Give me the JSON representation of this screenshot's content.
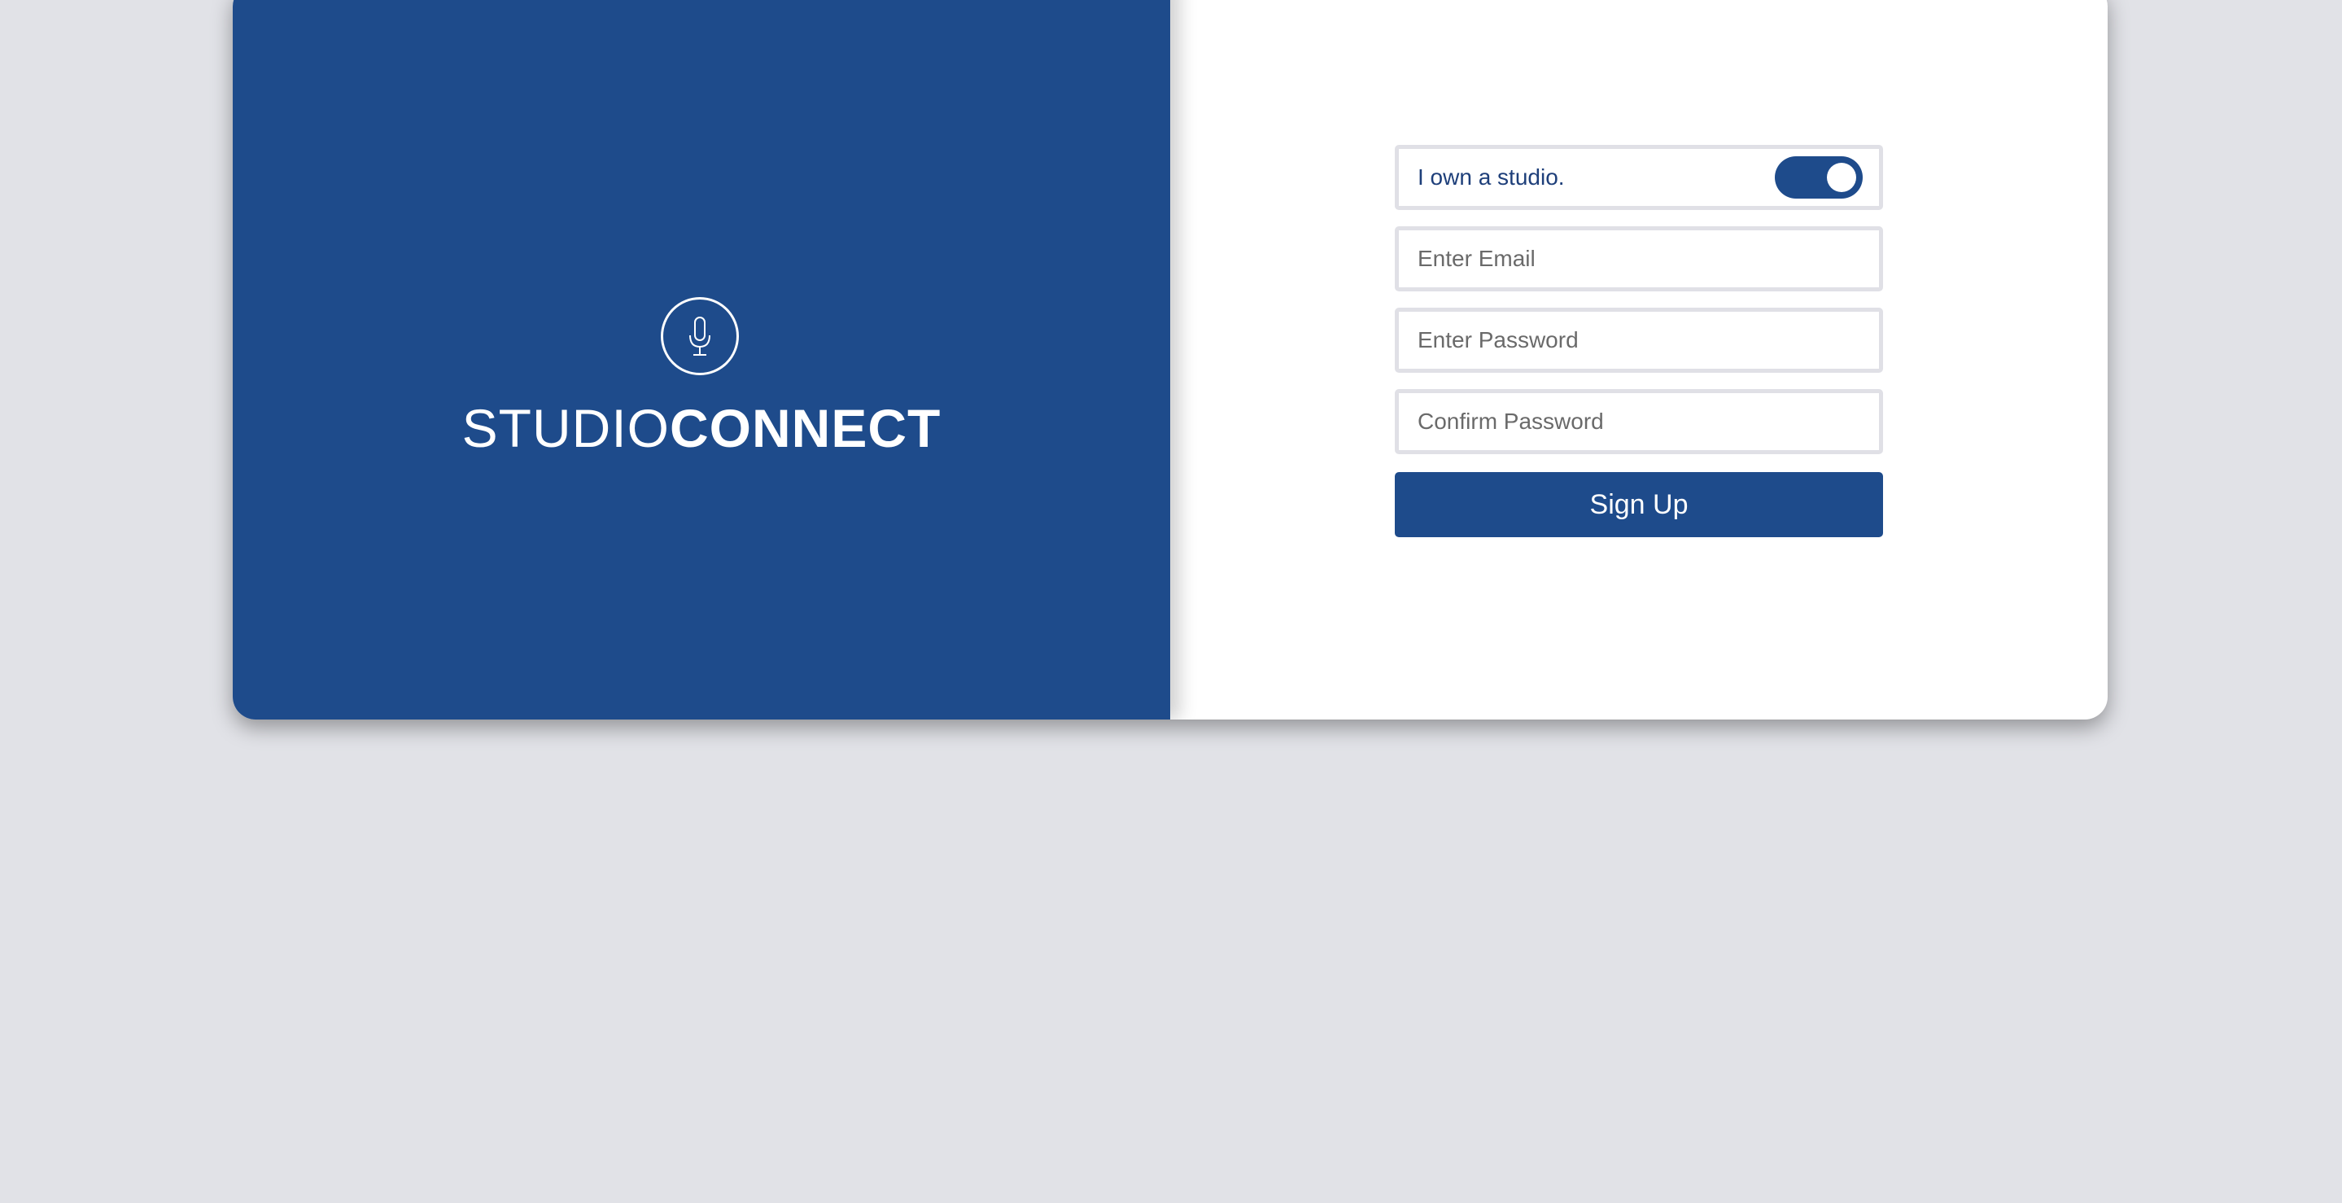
{
  "brand": {
    "icon": "microphone-icon",
    "name_light": "STUDIO",
    "name_bold": "CONNECT"
  },
  "form": {
    "owner_toggle": {
      "label": "I own a studio.",
      "checked": true
    },
    "email": {
      "value": "",
      "placeholder": "Enter Email"
    },
    "password": {
      "value": "",
      "placeholder": "Enter Password"
    },
    "confirm_password": {
      "value": "",
      "placeholder": "Confirm Password"
    },
    "submit_label": "Sign Up"
  },
  "colors": {
    "background": "#e1e2e7",
    "brand_blue": "#1e4b8b",
    "card": "#ffffff",
    "field_border": "#e0e0e6"
  }
}
